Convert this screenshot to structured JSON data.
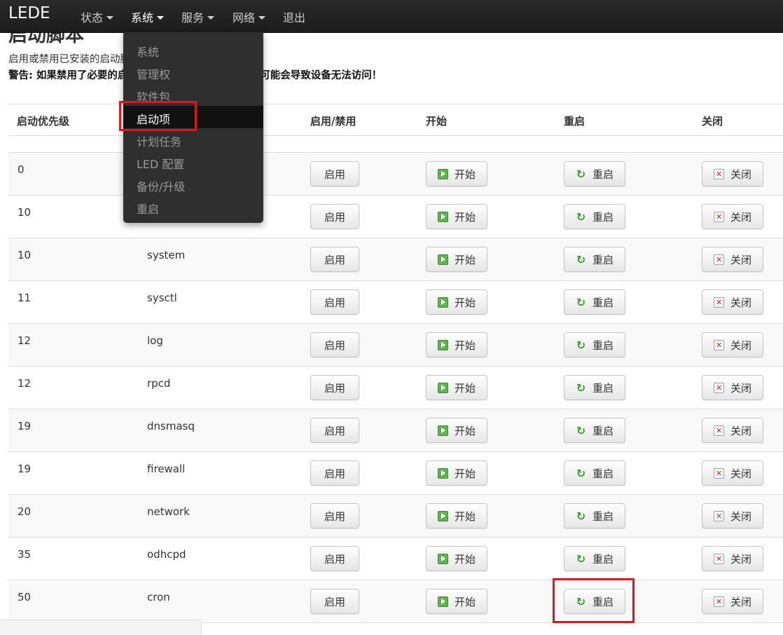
{
  "navbar": {
    "brand": "LEDE",
    "menus": [
      {
        "label": "状态"
      },
      {
        "label": "系统"
      },
      {
        "label": "服务"
      },
      {
        "label": "网络"
      },
      {
        "label": "退出"
      }
    ]
  },
  "page": {
    "title": "启动脚本",
    "description": "启用或禁用已安装的启动脚本。更改在设备重启后生效。",
    "warning": "警告: 如果禁用了必要的启动脚本，比如 \"network\"，可能会导致设备无法访问！"
  },
  "system_menu": {
    "items": [
      "系统",
      "管理权",
      "软件包",
      "启动项",
      "计划任务",
      "LED 配置",
      "备份/升级",
      "重启"
    ],
    "active": "启动项"
  },
  "table": {
    "headers": {
      "priority": "启动优先级",
      "toggle": "启用/禁用",
      "start": "开始",
      "restart": "重启",
      "stop": "关闭"
    },
    "button_labels": {
      "toggle": "启用",
      "start": "开始",
      "restart": "重启",
      "stop": "关闭"
    },
    "rows": [
      {
        "priority": "0",
        "name": ""
      },
      {
        "priority": "10",
        "name": ""
      },
      {
        "priority": "10",
        "name": "system"
      },
      {
        "priority": "11",
        "name": "sysctl"
      },
      {
        "priority": "12",
        "name": "log"
      },
      {
        "priority": "12",
        "name": "rpcd"
      },
      {
        "priority": "19",
        "name": "dnsmasq"
      },
      {
        "priority": "19",
        "name": "firewall"
      },
      {
        "priority": "20",
        "name": "network"
      },
      {
        "priority": "35",
        "name": "odhcpd"
      },
      {
        "priority": "50",
        "name": "cron"
      }
    ]
  },
  "highlights": [
    "启动项",
    "cron 重启"
  ],
  "colors": {
    "navbar": "#1c1c1c",
    "dropdown": "#2f2f2f",
    "highlight": "#e0141e",
    "start_icon": "#5fb64f",
    "restart_icon": "#3a9c2e",
    "stop_icon": "#dd2222"
  }
}
